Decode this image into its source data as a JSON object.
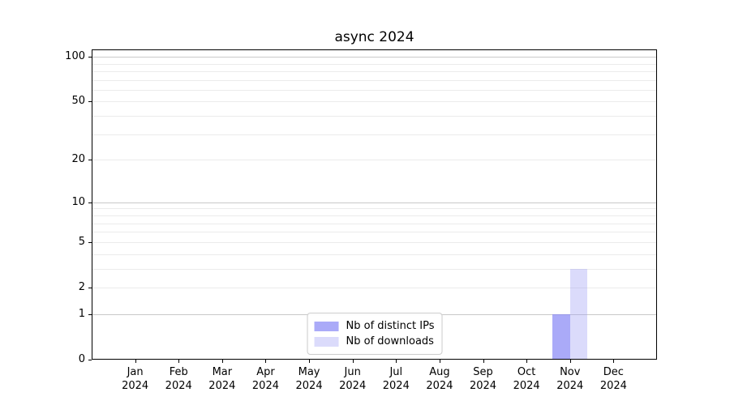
{
  "chart_data": {
    "type": "bar",
    "title": "async 2024",
    "categories": [
      "Jan 2024",
      "Feb 2024",
      "Mar 2024",
      "Apr 2024",
      "May 2024",
      "Jun 2024",
      "Jul 2024",
      "Aug 2024",
      "Sep 2024",
      "Oct 2024",
      "Nov 2024",
      "Dec 2024"
    ],
    "series": [
      {
        "name": "Nb of distinct IPs",
        "color": "rgba(125,125,245,0.65)",
        "values": [
          0,
          0,
          0,
          0,
          0,
          0,
          0,
          0,
          0,
          0,
          1,
          0
        ]
      },
      {
        "name": "Nb of downloads",
        "color": "rgba(160,160,245,0.38)",
        "values": [
          0,
          0,
          0,
          0,
          0,
          0,
          0,
          0,
          0,
          0,
          3,
          0
        ]
      }
    ],
    "yscale": "log1p",
    "ylim": [
      0,
      112
    ],
    "ytick_values": [
      0,
      1,
      2,
      5,
      10,
      20,
      50,
      100
    ],
    "ytick_labels": [
      "0",
      "1",
      "2",
      "5",
      "10",
      "20",
      "50",
      "100"
    ],
    "grid": {
      "major_values": [
        1,
        10,
        100
      ],
      "minor_values": [
        2,
        3,
        4,
        5,
        6,
        7,
        8,
        9,
        20,
        30,
        40,
        50,
        60,
        70,
        80,
        90
      ],
      "major_color": "#c9c9c9",
      "minor_color": "#ebebeb"
    },
    "legend_position": "lower center",
    "axis_color": "#000000",
    "background": "#ffffff"
  }
}
